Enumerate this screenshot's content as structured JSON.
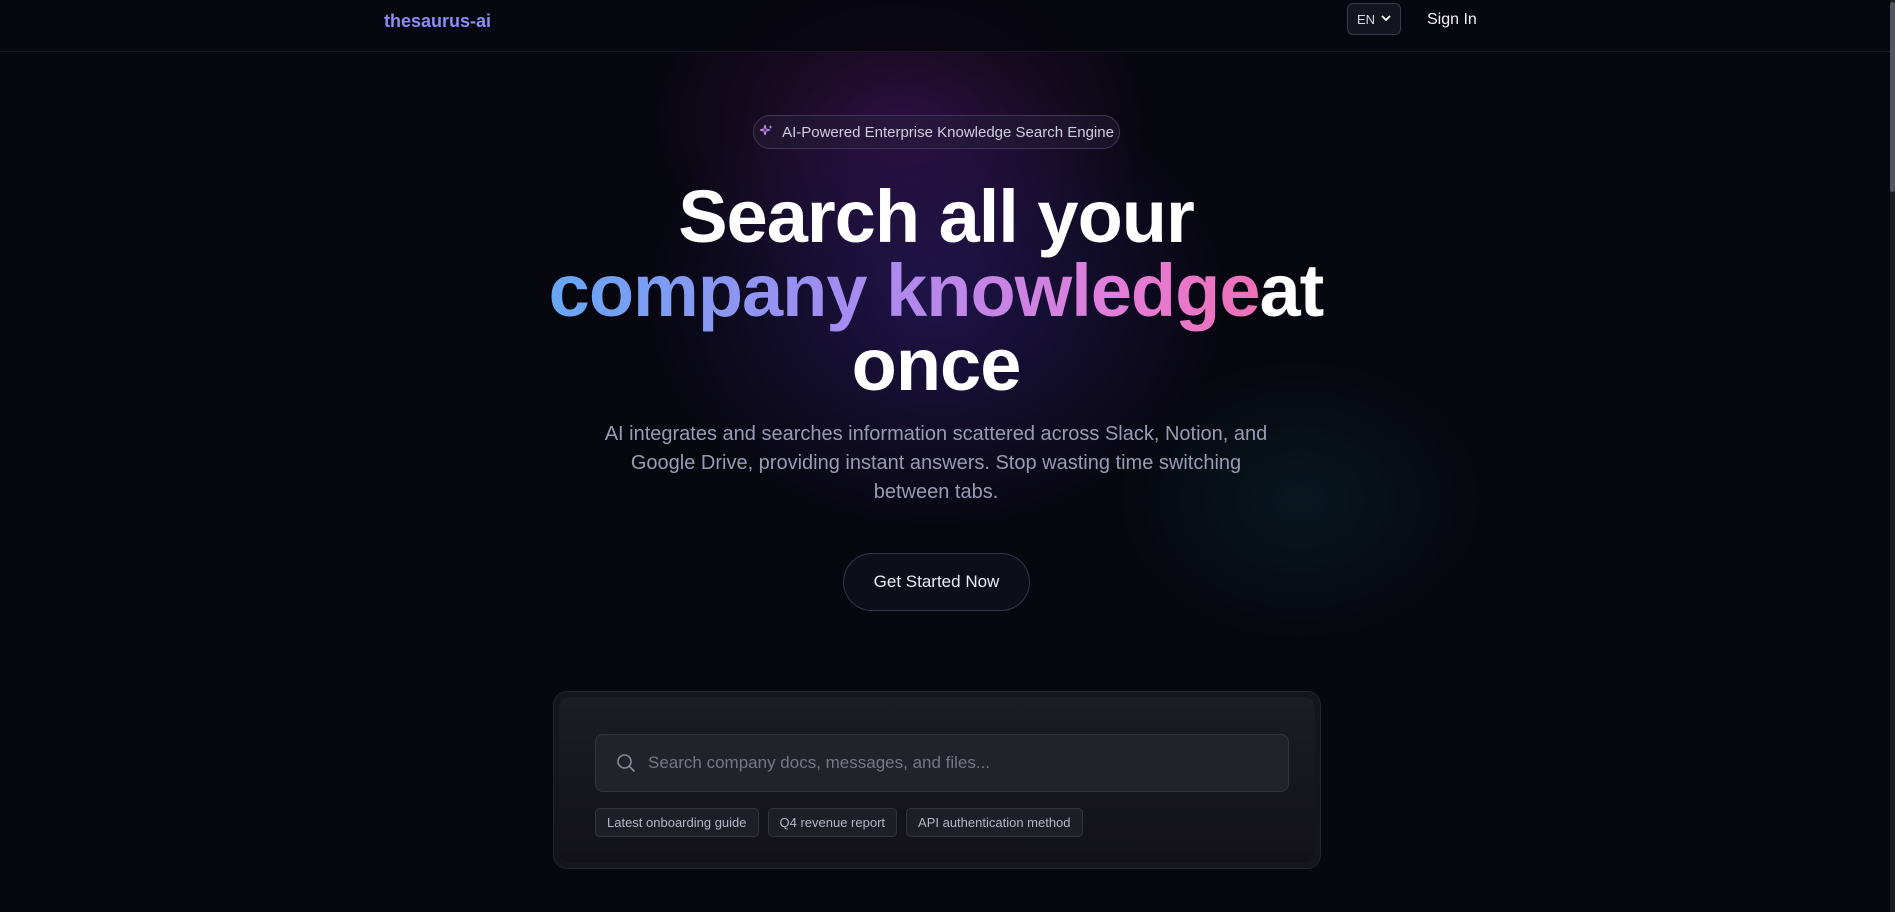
{
  "nav": {
    "logo": "thesaurus-ai",
    "language": "EN",
    "sign_in": "Sign In"
  },
  "hero": {
    "badge": "AI-Powered Enterprise Knowledge Search Engine",
    "headline_line1": "Search all your",
    "headline_gradient": "company knowledge",
    "headline_after": "at",
    "headline_line3": "once",
    "subtext": "AI integrates and searches information scattered across Slack, Notion, and Google Drive, providing instant answers. Stop wasting time switching between tabs.",
    "cta": "Get Started Now"
  },
  "search": {
    "placeholder": "Search company docs, messages, and files...",
    "suggestions": [
      "Latest onboarding guide",
      "Q4 revenue report",
      "API authentication method"
    ]
  },
  "colors": {
    "accent": "#8b8cf5",
    "gradient_start": "#66a6f5",
    "gradient_end": "#f06fb6",
    "background": "#07070f"
  },
  "icons": {
    "badge": "sparkle-icon",
    "search": "search-icon",
    "language": "chevron-down-icon"
  }
}
